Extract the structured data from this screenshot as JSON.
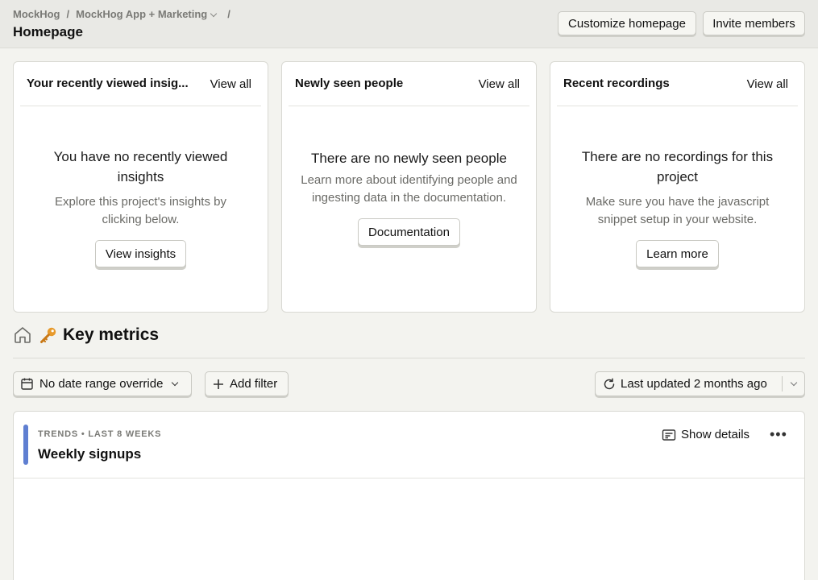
{
  "header": {
    "breadcrumbs": [
      "MockHog",
      "MockHog App + Marketing"
    ],
    "title": "Homepage",
    "customize_label": "Customize homepage",
    "invite_label": "Invite members"
  },
  "cards": [
    {
      "title": "Your recently viewed insights",
      "title_display": "Your recently viewed insig...",
      "view_all": "View all",
      "empty_title": "You have no recently viewed insights",
      "empty_desc": "Explore this project's insights by clicking below.",
      "button": "View insights"
    },
    {
      "title": "Newly seen people",
      "view_all": "View all",
      "empty_title": "There are no newly seen people",
      "empty_desc": "Learn more about identifying people and ingesting data in the documentation.",
      "button": "Documentation"
    },
    {
      "title": "Recent recordings",
      "view_all": "View all",
      "empty_title": "There are no recordings for this project",
      "empty_desc": "Make sure you have the javascript snippet setup in your website.",
      "button": "Learn more"
    }
  ],
  "dashboard": {
    "title": "Key metrics",
    "title_icon": "key-icon",
    "date_range_label": "No date range override",
    "add_filter_label": "Add filter",
    "last_updated_label": "Last updated 2 months ago"
  },
  "insight": {
    "meta": "TRENDS • LAST 8 WEEKS",
    "name": "Weekly signups",
    "show_details_label": "Show details",
    "accent_color": "#5f7fd1"
  }
}
